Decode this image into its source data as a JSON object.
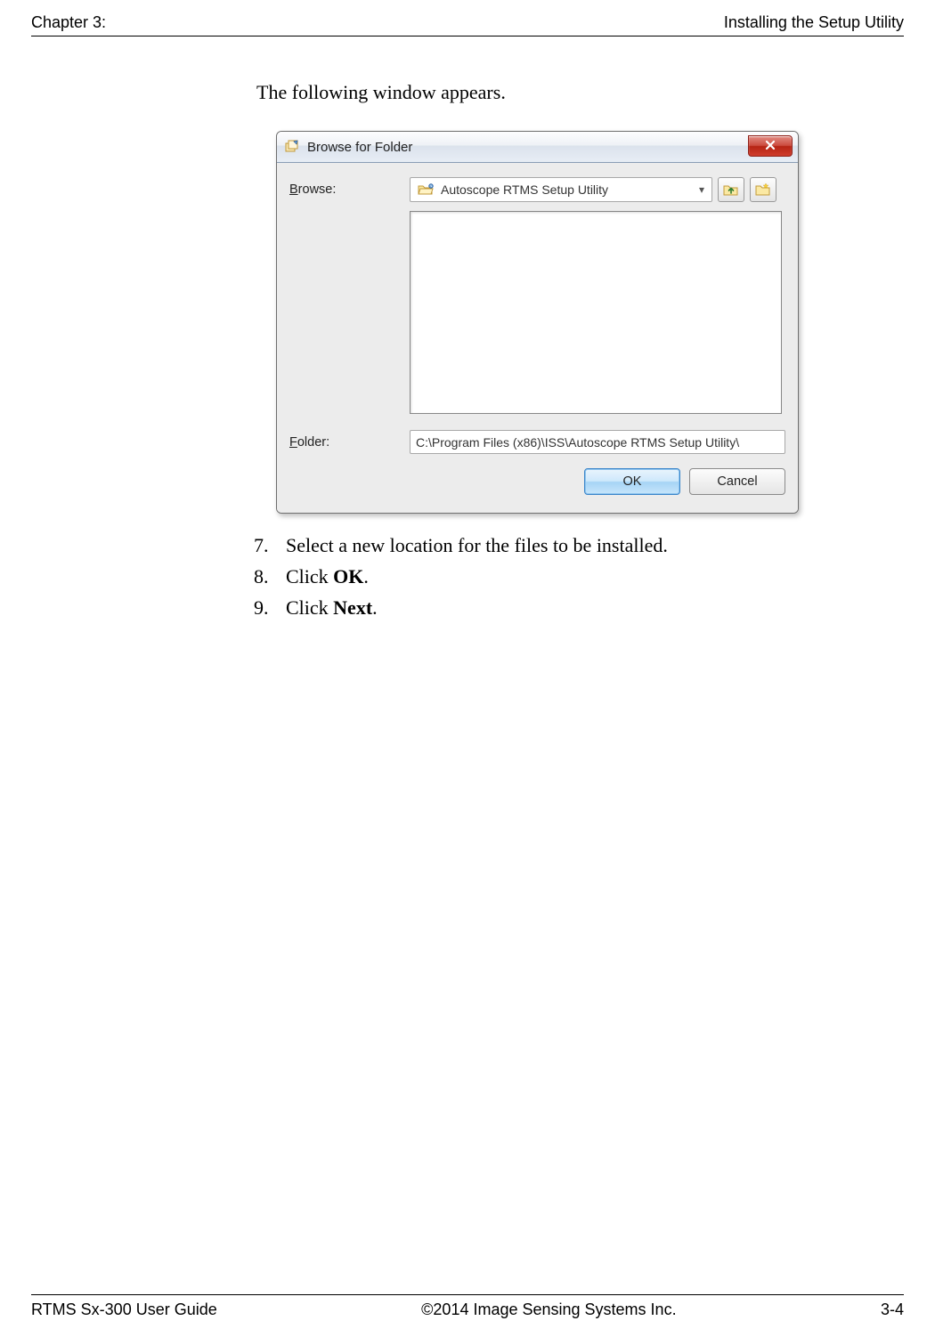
{
  "header": {
    "left": "Chapter 3:",
    "right": "Installing the Setup Utility"
  },
  "intro": "The following window appears.",
  "dialog": {
    "title": "Browse for Folder",
    "browse_label_pre": "B",
    "browse_label_post": "rowse:",
    "combo_text": "Autoscope RTMS Setup Utility",
    "folder_label_pre": "F",
    "folder_label_post": "older:",
    "folder_path": "C:\\Program Files (x86)\\ISS\\Autoscope RTMS Setup Utility\\",
    "ok": "OK",
    "cancel": "Cancel"
  },
  "steps": [
    {
      "num": "7.",
      "text_pre": "Select a new location for the files to be installed."
    },
    {
      "num": "8.",
      "text_pre": "Click ",
      "bold": "OK",
      "text_post": "."
    },
    {
      "num": "9.",
      "text_pre": "Click ",
      "bold": "Next",
      "text_post": "."
    }
  ],
  "footer": {
    "left": "RTMS Sx-300 User Guide",
    "center": "©2014 Image Sensing Systems Inc.",
    "right": "3-4"
  }
}
